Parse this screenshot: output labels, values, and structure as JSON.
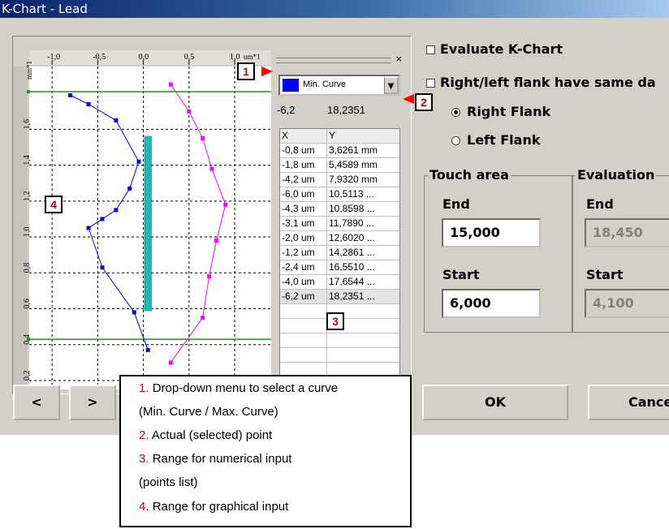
{
  "window": {
    "title": "K-Chart - Lead"
  },
  "chart": {
    "x_ticks": [
      "-1,0",
      "-0,5",
      "0,0",
      "0,5",
      "1,0"
    ],
    "x_unit": "um*1",
    "y_unit": "mm*1",
    "y_ticks": [
      "1,6",
      "1,4",
      "1,2",
      "1,0",
      "0,8",
      "0,6",
      "0,4",
      "0,2"
    ]
  },
  "chart_data": {
    "type": "line",
    "series": [
      {
        "color": "#0000ff",
        "points": [
          [
            -0.8,
            1.79
          ],
          [
            -0.6,
            1.74
          ],
          [
            -0.3,
            1.65
          ],
          [
            -0.05,
            1.42
          ],
          [
            -0.15,
            1.27
          ],
          [
            -0.3,
            1.15
          ],
          [
            -0.45,
            1.1
          ],
          [
            -0.6,
            1.05
          ],
          [
            -0.45,
            0.83
          ],
          [
            -0.1,
            0.58
          ],
          [
            0.05,
            0.37
          ]
        ]
      },
      {
        "color": "#ff00ff",
        "points": [
          [
            0.3,
            1.85
          ],
          [
            0.5,
            1.7
          ],
          [
            0.65,
            1.55
          ],
          [
            0.75,
            1.38
          ],
          [
            0.9,
            1.18
          ],
          [
            0.8,
            0.98
          ],
          [
            0.72,
            0.78
          ],
          [
            0.65,
            0.55
          ],
          [
            0.3,
            0.3
          ]
        ]
      }
    ],
    "markers": {
      "green_lines_y": [
        1.81,
        0.43
      ],
      "teal_bar": {
        "x": 0.05,
        "y_from": 1.55,
        "y_to": 0.6
      }
    },
    "ylim": [
      0.15,
      1.95
    ],
    "xlim": [
      -1.25,
      1.4
    ]
  },
  "curve_select": {
    "value": "Min. Curve",
    "color": "#0000ff"
  },
  "point": {
    "x": "-6,2",
    "y": "18,2351"
  },
  "table": {
    "headers": [
      "X",
      "Y"
    ],
    "rows": [
      [
        "-0,8 um",
        "3,6261 mm"
      ],
      [
        "-1,8 um",
        "5,4589 mm"
      ],
      [
        "-4,2 um",
        "7,9320 mm"
      ],
      [
        "-6,0 um",
        "10,5113 ..."
      ],
      [
        "-4,3 um",
        "10,8598 ..."
      ],
      [
        "-3,1 um",
        "11,7890 ..."
      ],
      [
        "-2,0 um",
        "12,6020 ..."
      ],
      [
        "-1,2 um",
        "14,2861 ..."
      ],
      [
        "-2,4 um",
        "16,5510 ..."
      ],
      [
        "-4,0 um",
        "17,6544 ..."
      ],
      [
        "-6,2 um",
        "18,2351 ..."
      ]
    ]
  },
  "options": {
    "evaluate": "Evaluate K-Chart",
    "same_data": "Right/left flank have same da",
    "right_flank": "Right Flank",
    "left_flank": "Left Flank"
  },
  "touch_area": {
    "title": "Touch area",
    "end_label": "End",
    "end_value": "15,000",
    "start_label": "Start",
    "start_value": "6,000"
  },
  "evaluation": {
    "title": "Evaluation",
    "end_label": "End",
    "end_value": "18,450",
    "start_label": "Start",
    "start_value": "4,100"
  },
  "buttons": {
    "prev": "<",
    "next": ">",
    "ok": "OK",
    "cancel": "Cance"
  },
  "badges": [
    "1",
    "2",
    "3",
    "4"
  ],
  "legend": {
    "l1_num": "1.",
    "l1": "Drop-down menu to select a curve",
    "l1b": "(Min. Curve / Max. Curve)",
    "l2_num": "2.",
    "l2": "Actual (selected) point",
    "l3_num": "3.",
    "l3": "Range for numerical input",
    "l3b": "(points list)",
    "l4_num": "4.",
    "l4": "Range for graphical input"
  }
}
